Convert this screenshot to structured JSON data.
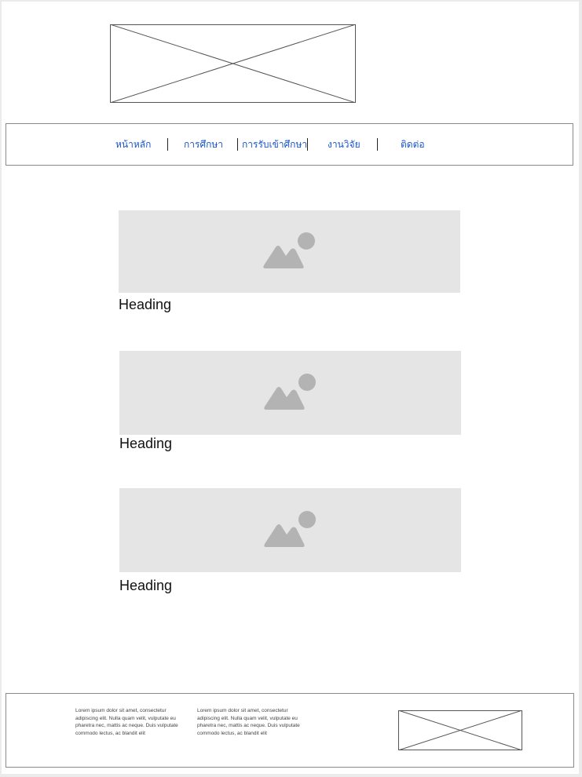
{
  "header": {
    "logo_icon": "image-placeholder-icon"
  },
  "nav": {
    "items": [
      {
        "label": "หน้าหลัก"
      },
      {
        "label": "การศึกษา"
      },
      {
        "label": "การรับเข้าศึกษา"
      },
      {
        "label": "งานวิจัย"
      },
      {
        "label": "ติดต่อ"
      }
    ]
  },
  "main": {
    "cards": [
      {
        "heading": "Heading",
        "image_icon": "image-icon"
      },
      {
        "heading": "Heading",
        "image_icon": "image-icon"
      },
      {
        "heading": "Heading",
        "image_icon": "image-icon"
      }
    ]
  },
  "footer": {
    "col1": "Lorem ipsum dolor sit amet, consectetur adipiscing elit. Nulla quam velit, vulputate eu pharetra nec, mattis ac neque. Duis vulputate commodo lectus, ac blandit elit",
    "col2": "Lorem ipsum dolor sit amet, consectetur adipiscing elit. Nulla quam velit, vulputate eu pharetra nec, mattis ac neque. Duis vulputate commodo lectus, ac blandit elit",
    "logo_icon": "image-placeholder-icon"
  },
  "colors": {
    "nav_link": "#1a56c8",
    "image_bg": "#e5e5e5",
    "image_icon": "#b3b3b3"
  }
}
